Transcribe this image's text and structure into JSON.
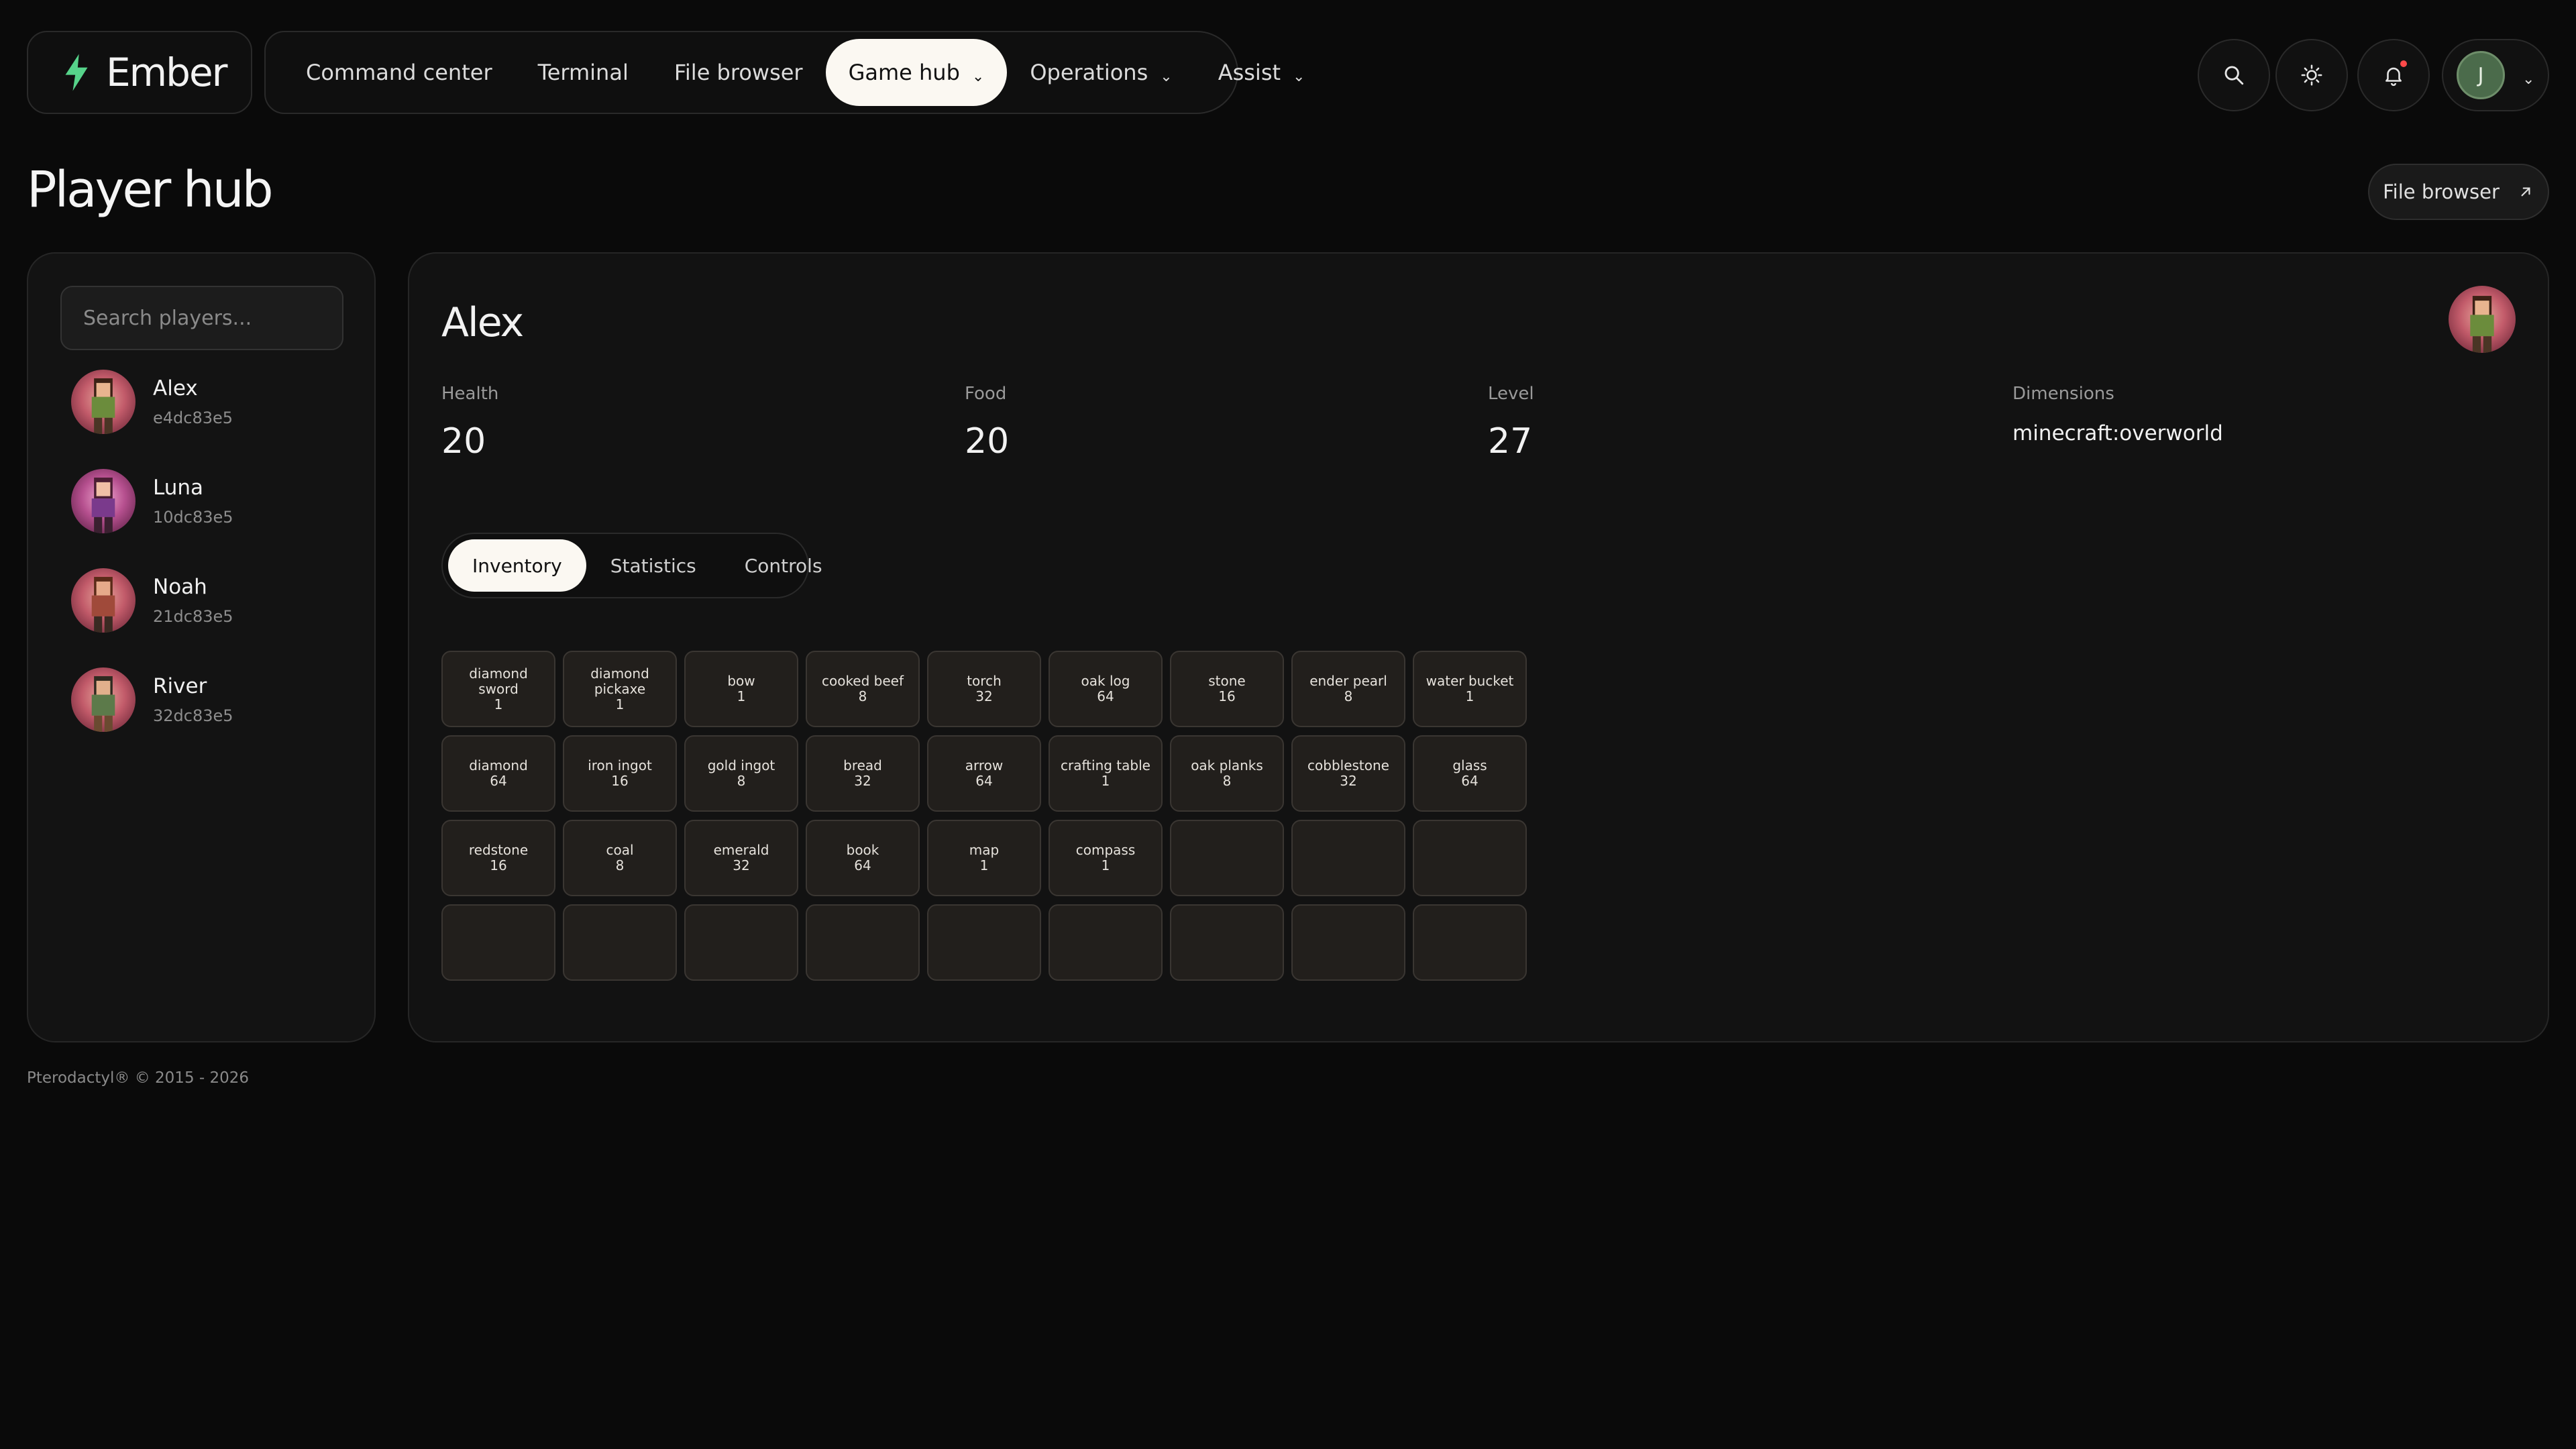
{
  "brand": {
    "name": "Ember",
    "icon": "bolt-icon",
    "accent": "#56d38a"
  },
  "nav": {
    "items": [
      {
        "label": "Command center",
        "active": false,
        "dropdown": false
      },
      {
        "label": "Terminal",
        "active": false,
        "dropdown": false
      },
      {
        "label": "File browser",
        "active": false,
        "dropdown": false
      },
      {
        "label": "Game hub",
        "active": true,
        "dropdown": true
      },
      {
        "label": "Operations",
        "active": false,
        "dropdown": true
      },
      {
        "label": "Assist",
        "active": false,
        "dropdown": true
      }
    ]
  },
  "header_actions": {
    "search_icon": "search-icon",
    "theme_icon": "sun-icon",
    "notifications_icon": "bell-icon",
    "user_initial": "J"
  },
  "page": {
    "title": "Player hub",
    "link_label": "File browser"
  },
  "sidebar": {
    "search_placeholder": "Search players...",
    "players": [
      {
        "name": "Alex",
        "id": "e4dc83e5"
      },
      {
        "name": "Luna",
        "id": "10dc83e5"
      },
      {
        "name": "Noah",
        "id": "21dc83e5"
      },
      {
        "name": "River",
        "id": "32dc83e5"
      }
    ]
  },
  "player": {
    "name": "Alex",
    "stats": [
      {
        "label": "Health",
        "value": "20"
      },
      {
        "label": "Food",
        "value": "20"
      },
      {
        "label": "Level",
        "value": "27"
      },
      {
        "label": "Dimensions",
        "value": "minecraft:overworld"
      }
    ],
    "tabs": [
      "Inventory",
      "Statistics",
      "Controls"
    ],
    "active_tab": "Inventory",
    "inventory": [
      {
        "name": "diamond sword",
        "count": "1"
      },
      {
        "name": "diamond pickaxe",
        "count": "1"
      },
      {
        "name": "bow",
        "count": "1"
      },
      {
        "name": "cooked beef",
        "count": "8"
      },
      {
        "name": "torch",
        "count": "32"
      },
      {
        "name": "oak log",
        "count": "64"
      },
      {
        "name": "stone",
        "count": "16"
      },
      {
        "name": "ender pearl",
        "count": "8"
      },
      {
        "name": "water bucket",
        "count": "1"
      },
      {
        "name": "diamond",
        "count": "64"
      },
      {
        "name": "iron ingot",
        "count": "16"
      },
      {
        "name": "gold ingot",
        "count": "8"
      },
      {
        "name": "bread",
        "count": "32"
      },
      {
        "name": "arrow",
        "count": "64"
      },
      {
        "name": "crafting table",
        "count": "1"
      },
      {
        "name": "oak planks",
        "count": "8"
      },
      {
        "name": "cobblestone",
        "count": "32"
      },
      {
        "name": "glass",
        "count": "64"
      },
      {
        "name": "redstone",
        "count": "16"
      },
      {
        "name": "coal",
        "count": "8"
      },
      {
        "name": "emerald",
        "count": "32"
      },
      {
        "name": "book",
        "count": "64"
      },
      {
        "name": "map",
        "count": "1"
      },
      {
        "name": "compass",
        "count": "1"
      }
    ],
    "total_slots": 36
  },
  "footer": {
    "text": "Pterodactyl® © 2015 - 2026"
  }
}
